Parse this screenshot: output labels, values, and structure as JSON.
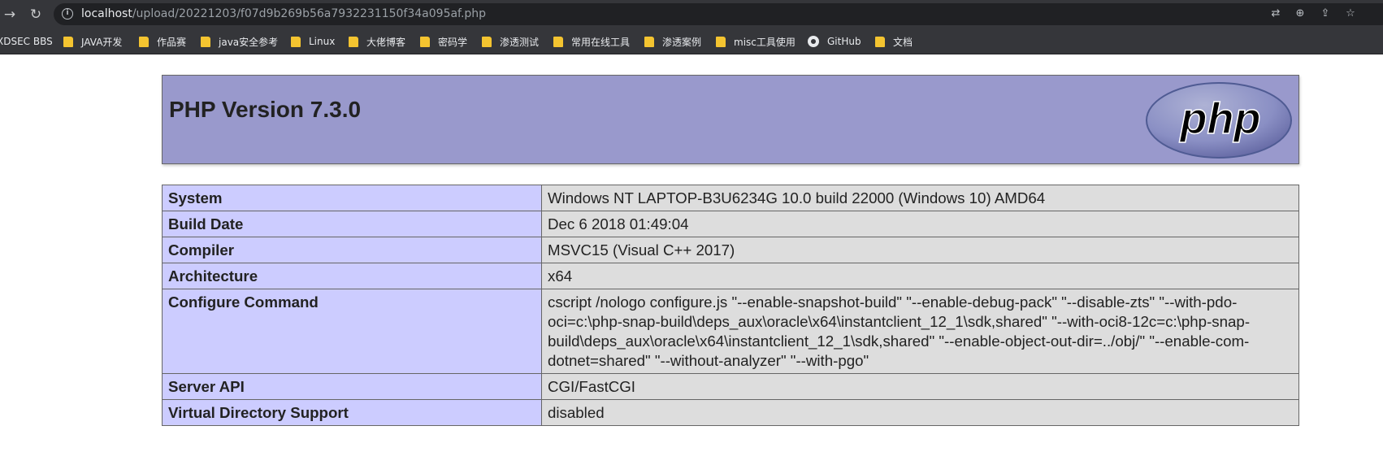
{
  "browser": {
    "url_host": "localhost",
    "url_path": "/upload/20221203/f07d9b269b56a7932231150f34a095af.php",
    "nav_back_icon": "arrow-right-icon",
    "reload_icon": "reload-icon",
    "bookmarks": [
      {
        "label": "XDSEC BBS",
        "icon": "none"
      },
      {
        "label": "JAVA开发",
        "icon": "folder-icon"
      },
      {
        "label": "作品赛",
        "icon": "folder-icon"
      },
      {
        "label": "java安全参考",
        "icon": "folder-icon"
      },
      {
        "label": "Linux",
        "icon": "folder-icon"
      },
      {
        "label": "大佬博客",
        "icon": "folder-icon"
      },
      {
        "label": "密码学",
        "icon": "folder-icon"
      },
      {
        "label": "渗透测试",
        "icon": "folder-icon"
      },
      {
        "label": "常用在线工具",
        "icon": "folder-icon"
      },
      {
        "label": "渗透案例",
        "icon": "folder-icon"
      },
      {
        "label": "misc工具使用",
        "icon": "folder-icon"
      },
      {
        "label": "GitHub",
        "icon": "github-icon"
      },
      {
        "label": "文档",
        "icon": "folder-icon"
      }
    ]
  },
  "page": {
    "title": "PHP Version 7.3.0",
    "logo_text": "php",
    "rows": [
      {
        "key": "System",
        "value": "Windows NT LAPTOP-B3U6234G 10.0 build 22000 (Windows 10) AMD64"
      },
      {
        "key": "Build Date",
        "value": "Dec 6 2018 01:49:04"
      },
      {
        "key": "Compiler",
        "value": "MSVC15 (Visual C++ 2017)"
      },
      {
        "key": "Architecture",
        "value": "x64"
      },
      {
        "key": "Configure Command",
        "value": "cscript /nologo configure.js \"--enable-snapshot-build\" \"--enable-debug-pack\" \"--disable-zts\" \"--with-pdo-oci=c:\\php-snap-build\\deps_aux\\oracle\\x64\\instantclient_12_1\\sdk,shared\" \"--with-oci8-12c=c:\\php-snap-build\\deps_aux\\oracle\\x64\\instantclient_12_1\\sdk,shared\" \"--enable-object-out-dir=../obj/\" \"--enable-com-dotnet=shared\" \"--without-analyzer\" \"--with-pgo\""
      },
      {
        "key": "Server API",
        "value": "CGI/FastCGI"
      },
      {
        "key": "Virtual Directory Support",
        "value": "disabled"
      }
    ]
  },
  "colors": {
    "header_bg": "#9999cc",
    "key_cell_bg": "#ccccff",
    "value_cell_bg": "#dddddd",
    "chrome_bg": "#35363a"
  }
}
